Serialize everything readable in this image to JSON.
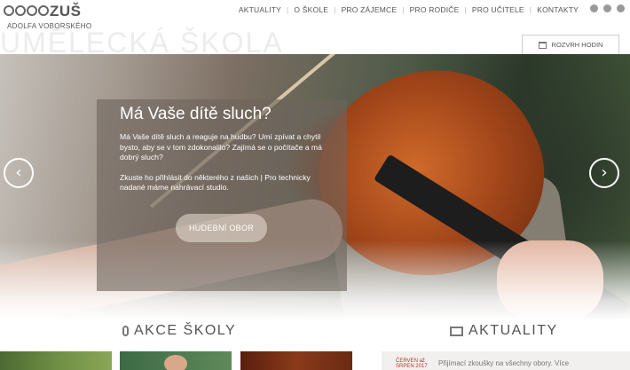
{
  "header": {
    "logo_text": "ZUŠ",
    "logo_sub": "ADOLFA VOBORSKÉHO",
    "ghost_title": "UMĚLECKÁ ŠKOLA",
    "nav": [
      "AKTUALITY",
      "O ŠKOLE",
      "PRO ZÁJEMCE",
      "PRO RODIČE",
      "PRO UČITELE",
      "KONTAKTY"
    ],
    "social_icons": [
      "pinterest-icon",
      "twitter-icon",
      "facebook-icon"
    ],
    "schedule_label": "ROZVRH HODIN"
  },
  "hero": {
    "title": "Má Vaše dítě sluch?",
    "paragraph1": "Má Vaše dítě sluch a reaguje na hudbu? Umí zpívat a chytil bysto, aby se v tom zdokonalilo? Zajímá se o počítače a má dobrý sluch?",
    "paragraph2": "Zkuste ho přihlásit do některého z našich | Pro technicky nadané máme nahrávací studio.",
    "button_label": "HUDEBNÍ OBOR",
    "prev_icon": "‹",
    "next_icon": "›"
  },
  "sections": {
    "events_title": "AKCE ŠKOLY",
    "news_title": "AKTUALITY"
  },
  "news": {
    "date_line1": "ČERVEN až",
    "date_line2": "SRPEN 2017",
    "text": "Přijímací zkoušky na všechny obory. Více"
  }
}
